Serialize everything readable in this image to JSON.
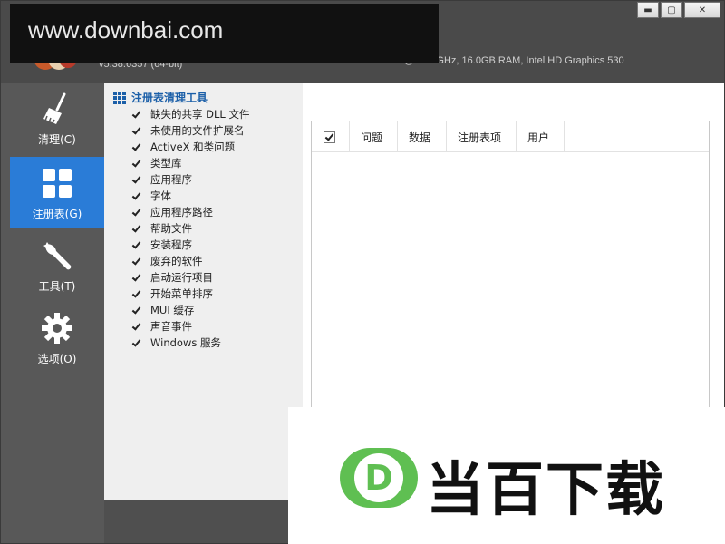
{
  "app": {
    "version": "v5.38.6357 (64-bit)",
    "sysinfo": "Intel Core i5-6500 CPU @ 3.20GHz, 16.0GB RAM, Intel HD Graphics 530"
  },
  "window_controls": {
    "minimize": "▬",
    "maximize": "▢",
    "close": "✕"
  },
  "watermark": {
    "text": "www.downbai.com"
  },
  "nav": {
    "items": [
      {
        "label": "清理(C)",
        "icon": "broom-icon"
      },
      {
        "label": "注册表(G)",
        "icon": "grid-icon"
      },
      {
        "label": "工具(T)",
        "icon": "wrench-icon"
      },
      {
        "label": "选项(O)",
        "icon": "gear-icon"
      }
    ],
    "active": "注册表(G)"
  },
  "options": {
    "title": "注册表清理工具",
    "items": [
      {
        "label": "缺失的共享 DLL 文件",
        "checked": true
      },
      {
        "label": "未使用的文件扩展名",
        "checked": true
      },
      {
        "label": "ActiveX 和类问题",
        "checked": true
      },
      {
        "label": "类型库",
        "checked": true
      },
      {
        "label": "应用程序",
        "checked": true
      },
      {
        "label": "字体",
        "checked": true
      },
      {
        "label": "应用程序路径",
        "checked": true
      },
      {
        "label": "帮助文件",
        "checked": true
      },
      {
        "label": "安装程序",
        "checked": true
      },
      {
        "label": "废弃的软件",
        "checked": true
      },
      {
        "label": "启动运行项目",
        "checked": true
      },
      {
        "label": "开始菜单排序",
        "checked": true
      },
      {
        "label": "MUI 缓存",
        "checked": true
      },
      {
        "label": "声音事件",
        "checked": true
      },
      {
        "label": "Windows 服务",
        "checked": true
      }
    ]
  },
  "results_table": {
    "columns": [
      "问题",
      "数据",
      "注册表项",
      "用户"
    ],
    "select_all_checked": true,
    "rows": []
  },
  "brand": {
    "mark": "D",
    "name": "当百下载",
    "accent": "#5fbf52"
  },
  "colors": {
    "nav_active": "#2a7cd7",
    "title_blue": "#1b5fa8"
  }
}
